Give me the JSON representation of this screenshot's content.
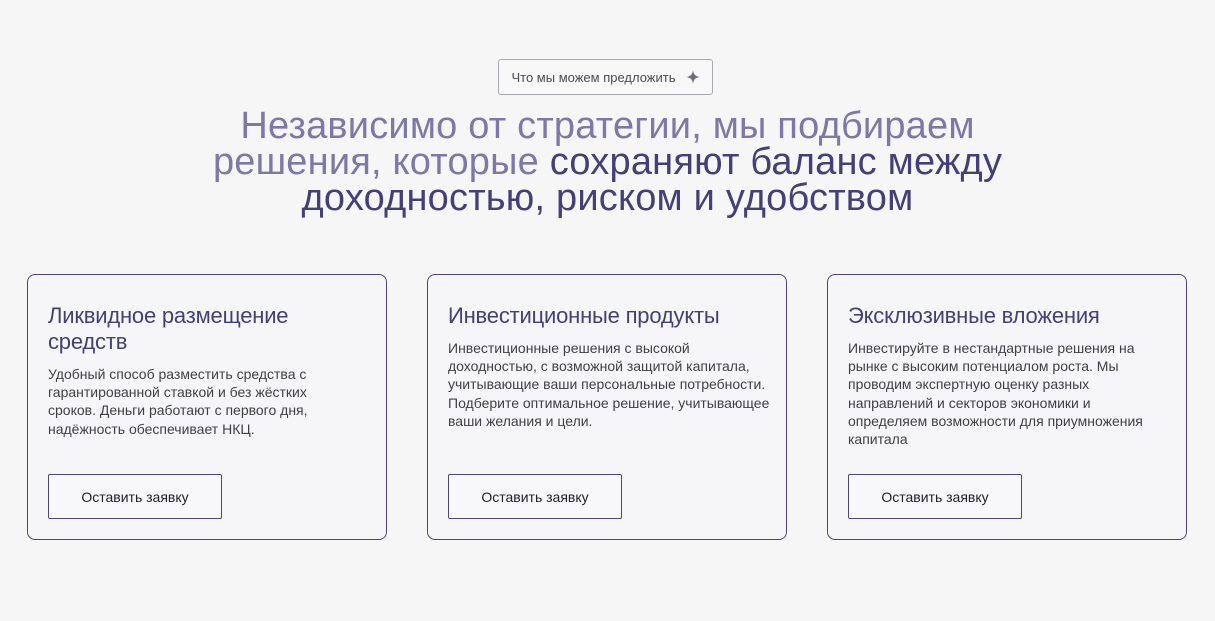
{
  "badge": {
    "label": "Что мы можем предложить",
    "icon": "sparkle-icon"
  },
  "headline": {
    "light_line1": "Независимо от стратегии, мы подбираем",
    "light_line2": "решения, которые ",
    "dark_line2": "сохраняют баланс между",
    "dark_line3": "доходностью, риском и удобством"
  },
  "colors": {
    "headline_light": "#7d78a8",
    "headline_dark": "#443f78",
    "border": "#4b4680",
    "background": "#f6f6f6"
  },
  "cards": [
    {
      "title": "Ликвидное размещение средств",
      "text": "Удобный способ разместить средства с гарантированной ставкой и без жёстких сроков. Деньги работают с первого дня, надёжность обеспечивает НКЦ.",
      "button": "Оставить заявку"
    },
    {
      "title": "Инвестиционные продукты",
      "text": "Инвестиционные решения с высокой доходностью, с возможной защитой капитала, учитывающие ваши персональные потребности. Подберите оптимальное решение, учитывающее ваши желания и цели.",
      "button": "Оставить заявку"
    },
    {
      "title": "Эксклюзивные вложения",
      "text": "Инвестируйте в нестандартные решения на рынке с высоким потенциалом роста. Мы проводим экспертную оценку разных направлений и секторов экономики и определяем возможности для приумножения капитала",
      "button": "Оставить заявку"
    }
  ]
}
